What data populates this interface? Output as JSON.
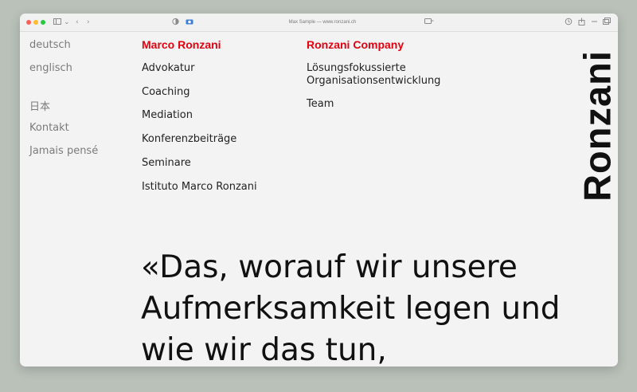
{
  "browser": {
    "address": "Max Sample — www.ronzani.ch"
  },
  "sidebar": {
    "items": [
      "deutsch",
      "englisch",
      "日本",
      "Kontakt",
      "Jamais pensé"
    ]
  },
  "col1": {
    "title": "Marco Ronzani",
    "items": [
      "Advokatur",
      "Coaching",
      "Mediation",
      "Konferenzbeiträge",
      "Seminare",
      "Istituto Marco Ronzani"
    ]
  },
  "col2": {
    "title": "Ronzani Company",
    "items": [
      "Lösungsfokussierte Organisationsentwicklung",
      "Team"
    ]
  },
  "logo": "Ronzani",
  "quote": "«Das, worauf wir unsere Aufmerksamkeit legen und wie wir das tun,",
  "colors": {
    "accent": "#e3000f",
    "text": "#111111",
    "muted": "#7b7b7b",
    "background": "#f3f3f3"
  },
  "icons": [
    "sidebar-toggle-icon",
    "chevron-down-icon",
    "back-arrow-icon",
    "forward-arrow-icon",
    "privacy-shield-icon",
    "camera-icon",
    "translate-icon",
    "history-icon",
    "share-icon",
    "new-tab-icon",
    "tabs-icon"
  ]
}
